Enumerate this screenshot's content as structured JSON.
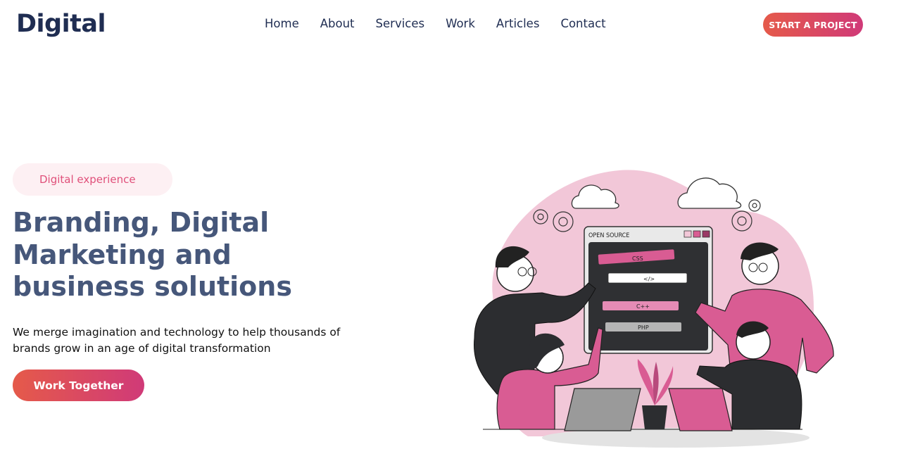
{
  "header": {
    "logo": "Digital",
    "nav": [
      "Home",
      "About",
      "Services",
      "Work",
      "Articles",
      "Contact"
    ],
    "cta": "START A PROJECT"
  },
  "hero": {
    "badge": "Digital experience",
    "headline": "Branding, Digital Marketing and business solutions",
    "subtitle": "We merge imagination and technology to help thousands of brands grow in an age of digital transformation",
    "cta": "Work Together"
  },
  "illustration": {
    "window_title": "OPEN SOURCE",
    "tags": [
      "CSS",
      "</>",
      "C++",
      "PHP"
    ]
  },
  "colors": {
    "brand_dark": "#1f2d52",
    "headline": "#46577a",
    "accent_start": "#e55a4a",
    "accent_end": "#d03a78",
    "pink": "#d95c93",
    "blob": "#f2c7d8"
  }
}
